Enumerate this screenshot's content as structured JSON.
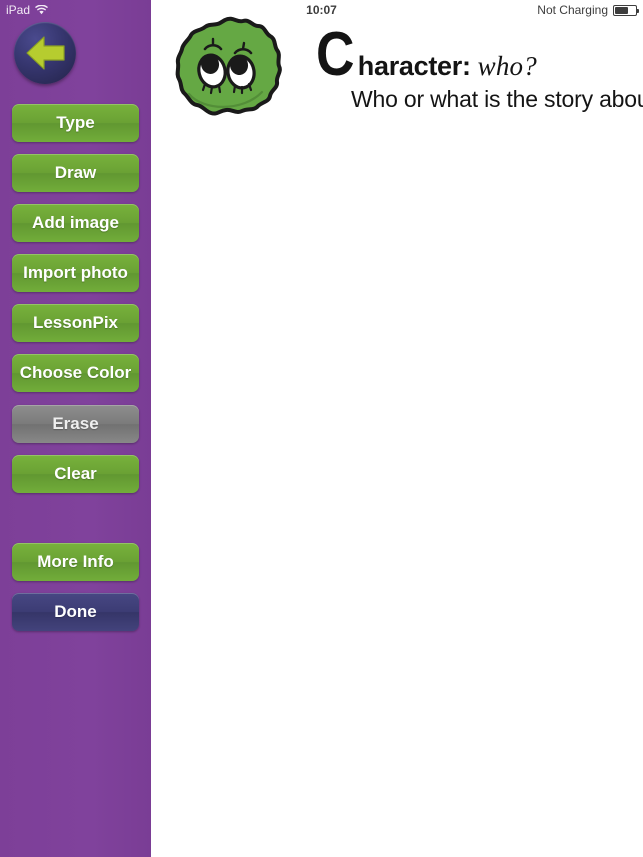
{
  "statusbar": {
    "device_label": "iPad",
    "wifi_icon": "wifi-icon",
    "time": "10:07",
    "charging_status": "Not Charging",
    "battery_icon": "battery-icon",
    "battery_level_percent": 60
  },
  "sidebar": {
    "background_color": "#7f409b",
    "back_button": {
      "icon": "back-arrow-icon",
      "arrow_color": "#b6cc2f",
      "circle_color": "#36366f"
    },
    "buttons": [
      {
        "label": "Type",
        "style": "green",
        "name": "type-button"
      },
      {
        "label": "Draw",
        "style": "green",
        "name": "draw-button"
      },
      {
        "label": "Add image",
        "style": "green",
        "name": "add-image-button"
      },
      {
        "label": "Import photo",
        "style": "green",
        "name": "import-photo-button"
      },
      {
        "label": "LessonPix",
        "style": "green",
        "name": "lessonpix-button"
      },
      {
        "label": "Choose Color",
        "style": "green",
        "name": "choose-color-button"
      },
      {
        "label": "Erase",
        "style": "gray",
        "name": "erase-button"
      },
      {
        "label": "Clear",
        "style": "green",
        "name": "clear-button"
      },
      {
        "label": "More Info",
        "style": "green",
        "name": "more-info-button"
      },
      {
        "label": "Done",
        "style": "navy",
        "name": "done-button"
      }
    ]
  },
  "main": {
    "mascot_icon": "green-fuzzy-monster-icon",
    "mascot_color": "#65a844",
    "title_dropcap": "C",
    "title_rest": "haracter:",
    "title_italic": "who?",
    "subtitle": "Who or what is the story about?",
    "canvas_background": "#ffffff"
  }
}
